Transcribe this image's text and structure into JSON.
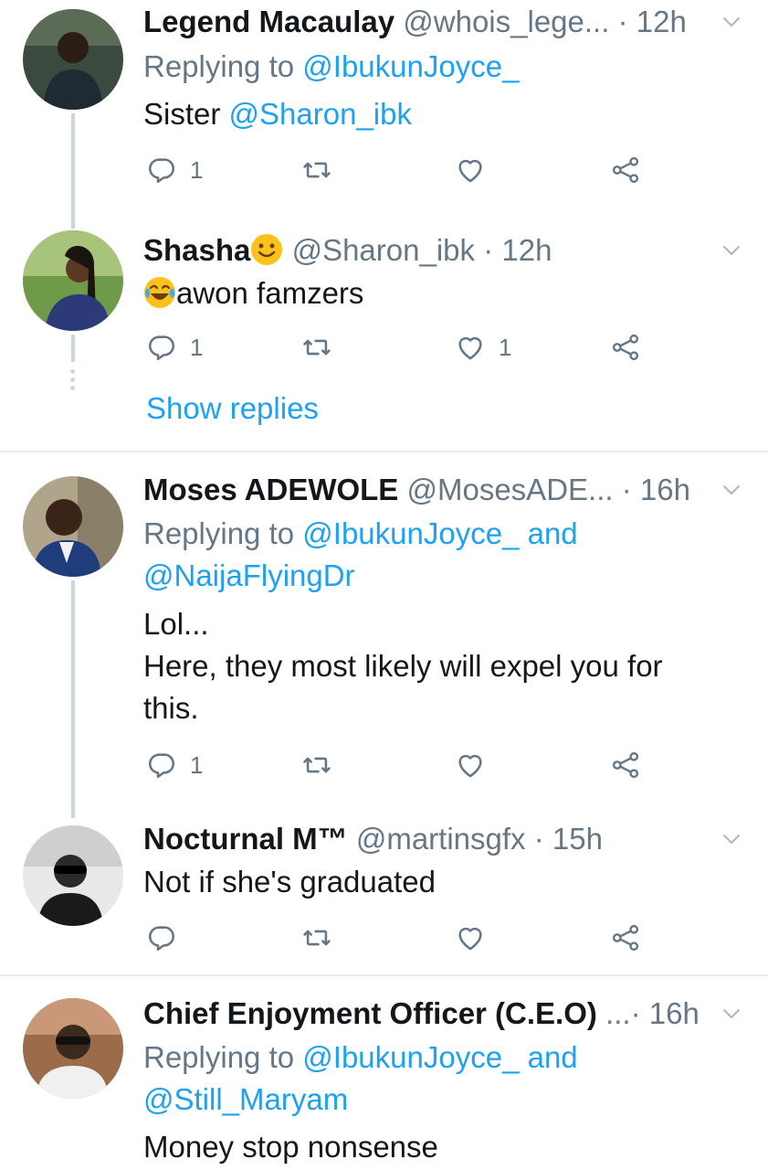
{
  "tweets": [
    {
      "name": "Legend Macaulay",
      "handle": "@whois_lege...",
      "time": "12h",
      "replying_label": "Replying to",
      "replying_to": "@IbukunJoyce_",
      "text_prefix": "Sister",
      "text_mention": "@Sharon_ibk",
      "reply_count": "1",
      "like_count": ""
    },
    {
      "name": "Shasha",
      "handle": "@Sharon_ibk",
      "time": "12h",
      "text": "awon famzers",
      "reply_count": "1",
      "like_count": "1",
      "show_replies": "Show replies"
    },
    {
      "name": "Moses ADEWOLE",
      "handle": "@MosesADE...",
      "time": "16h",
      "replying_label": "Replying to",
      "replying_to": "@IbukunJoyce_",
      "and_label": "and",
      "replying_to_2": "@NaijaFlyingDr",
      "text_lines": [
        "Lol...",
        "Here, they most likely will expel you for",
        "this."
      ],
      "reply_count": "1"
    },
    {
      "name": "Nocturnal M™",
      "handle": "@martinsgfx",
      "time": "15h",
      "text": "Not if she's graduated"
    },
    {
      "name": "Chief Enjoyment Officer (C.E.O)",
      "handle": "...",
      "time": "16h",
      "replying_label": "Replying to",
      "replying_to": "@IbukunJoyce_",
      "and_label": "and",
      "replying_to_2": "@Still_Maryam",
      "text": "Money stop nonsense"
    }
  ],
  "icons": {
    "reply": "reply-icon",
    "retweet": "retweet-icon",
    "like": "heart-icon",
    "share": "share-icon",
    "caret": "chevron-down-icon"
  },
  "colors": {
    "link": "#1da1f2",
    "secondary": "#657786",
    "text": "#14171a",
    "divider": "#e6ecf0"
  },
  "separator": "·"
}
